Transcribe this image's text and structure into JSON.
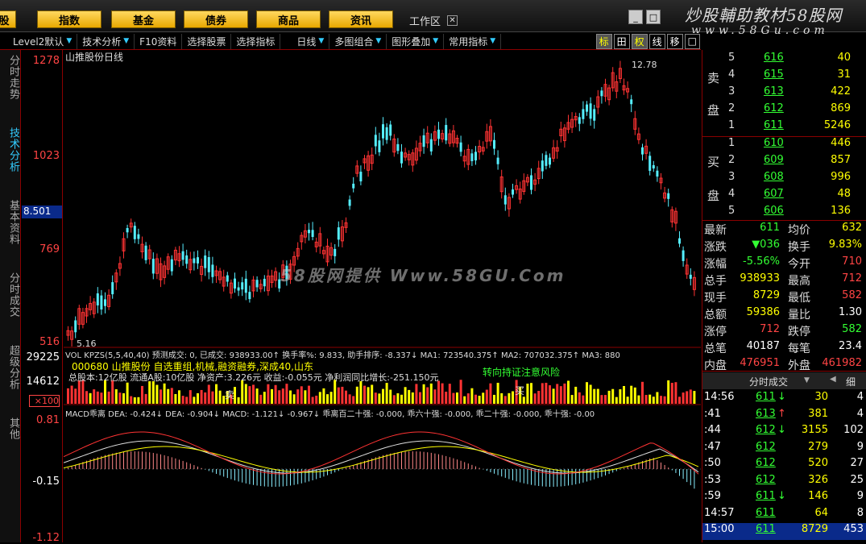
{
  "topbar": {
    "buttons": [
      "股",
      "指数",
      "基金",
      "债券",
      "商品",
      "资讯"
    ],
    "workspace": "工作区",
    "logo_line1": "炒股輔助教材58股网",
    "logo_line2": "www.58Gu.com"
  },
  "toolbar": {
    "items": [
      "Level2默认",
      "技术分析",
      "F10资料",
      "选择股票",
      "选择指标",
      "日线",
      "多图组合",
      "图形叠加",
      "常用指标"
    ],
    "boxes": [
      "标",
      "田",
      "权",
      "线",
      "移",
      "□"
    ]
  },
  "leftnav": [
    "分时走势",
    "技术分析",
    "基本资料",
    "分时成交",
    "超级分析",
    "其他"
  ],
  "axis": {
    "price": [
      "1278",
      "1023",
      "769",
      "516"
    ],
    "vol": [
      "29225",
      "14612",
      "×100"
    ],
    "macd": [
      "0.81",
      "-0.15",
      "-1.12"
    ],
    "current": "8.501"
  },
  "chart": {
    "title": "山推股份日线",
    "high_label": "12.78",
    "low_label": "5.16",
    "vol_header": "VOL KPZS(5,5,40,40)  预测成交: 0, 已成交: 938933.00↑  换手率%: 9.833, 助手排序: -8.337↓  MA1: 723540.375↑  MA2: 707032.375↑  MA3: 880",
    "info_line1": "000680  山推股份  自选重组,机械,融资融券,深成40,山东",
    "info_line2": "总股本:12亿股  流通A股:10亿股  净资产:3.226元  收益:-0.055元  净利润同比增长:-251.150元",
    "info_tip": "转向持证注意风险",
    "buy_label": "买",
    "sell_label": "卖",
    "macd_header": "MACD乖离  DEA: -0.424↓  DEA: -0.904↓  MACD: -1.121↓  -0.967↓  乖离百二十强: -0.000,  乖六十强: -0.000,  乖二十强: -0.000,  乖十强: -0.00"
  },
  "watermark": "58股网提供  Www.58GU.Com",
  "orderbook": {
    "sell": [
      {
        "n": "5",
        "p": "616",
        "v": "40"
      },
      {
        "n": "4",
        "p": "615",
        "v": "31"
      },
      {
        "n": "3",
        "p": "613",
        "v": "422"
      },
      {
        "n": "2",
        "p": "612",
        "v": "869"
      },
      {
        "n": "1",
        "p": "611",
        "v": "5246"
      }
    ],
    "buy": [
      {
        "n": "1",
        "p": "610",
        "v": "446"
      },
      {
        "n": "2",
        "p": "609",
        "v": "857"
      },
      {
        "n": "3",
        "p": "608",
        "v": "996"
      },
      {
        "n": "4",
        "p": "607",
        "v": "48"
      },
      {
        "n": "5",
        "p": "606",
        "v": "136"
      }
    ],
    "sell_label": [
      "卖",
      "盘"
    ],
    "buy_label": [
      "买",
      "盘"
    ]
  },
  "stats": [
    {
      "l": "最新",
      "v": "611",
      "l2": "均价",
      "v2": "632"
    },
    {
      "l": "涨跌",
      "v": "▼036",
      "l2": "换手",
      "v2": "9.83%"
    },
    {
      "l": "涨幅",
      "v": "-5.56%",
      "l2": "今开",
      "v2": "710"
    },
    {
      "l": "总手",
      "v": "938933",
      "l2": "最高",
      "v2": "712"
    },
    {
      "l": "现手",
      "v": "8729",
      "l2": "最低",
      "v2": "582"
    },
    {
      "l": "总额",
      "v": "59386",
      "l2": "量比",
      "v2": "1.30"
    },
    {
      "l": "涨停",
      "v": "712",
      "l2": "跌停",
      "v2": "582"
    },
    {
      "l": "总笔",
      "v": "40187",
      "l2": "每笔",
      "v2": "23.4"
    },
    {
      "l": "内盘",
      "v": "476951",
      "l2": "外盘",
      "v2": "461982"
    }
  ],
  "ticks_header": {
    "title": "分时成交",
    "arrow": "◀",
    "detail": "细"
  },
  "ticks": [
    {
      "t": "14:56",
      "p": "611",
      "a": "↓",
      "v": "30",
      "n": "4"
    },
    {
      "t": ":41",
      "p": "613",
      "a": "↑",
      "v": "381",
      "n": "4"
    },
    {
      "t": ":44",
      "p": "612",
      "a": "↓",
      "v": "3155",
      "n": "102"
    },
    {
      "t": ":47",
      "p": "612",
      "a": "",
      "v": "279",
      "n": "9"
    },
    {
      "t": ":50",
      "p": "612",
      "a": "",
      "v": "520",
      "n": "27"
    },
    {
      "t": ":53",
      "p": "612",
      "a": "",
      "v": "326",
      "n": "25"
    },
    {
      "t": ":59",
      "p": "611",
      "a": "↓",
      "v": "146",
      "n": "9"
    },
    {
      "t": "14:57",
      "p": "611",
      "a": "",
      "v": "64",
      "n": "8"
    },
    {
      "t": "15:00",
      "p": "611",
      "a": "",
      "v": "8729",
      "n": "453"
    }
  ]
}
